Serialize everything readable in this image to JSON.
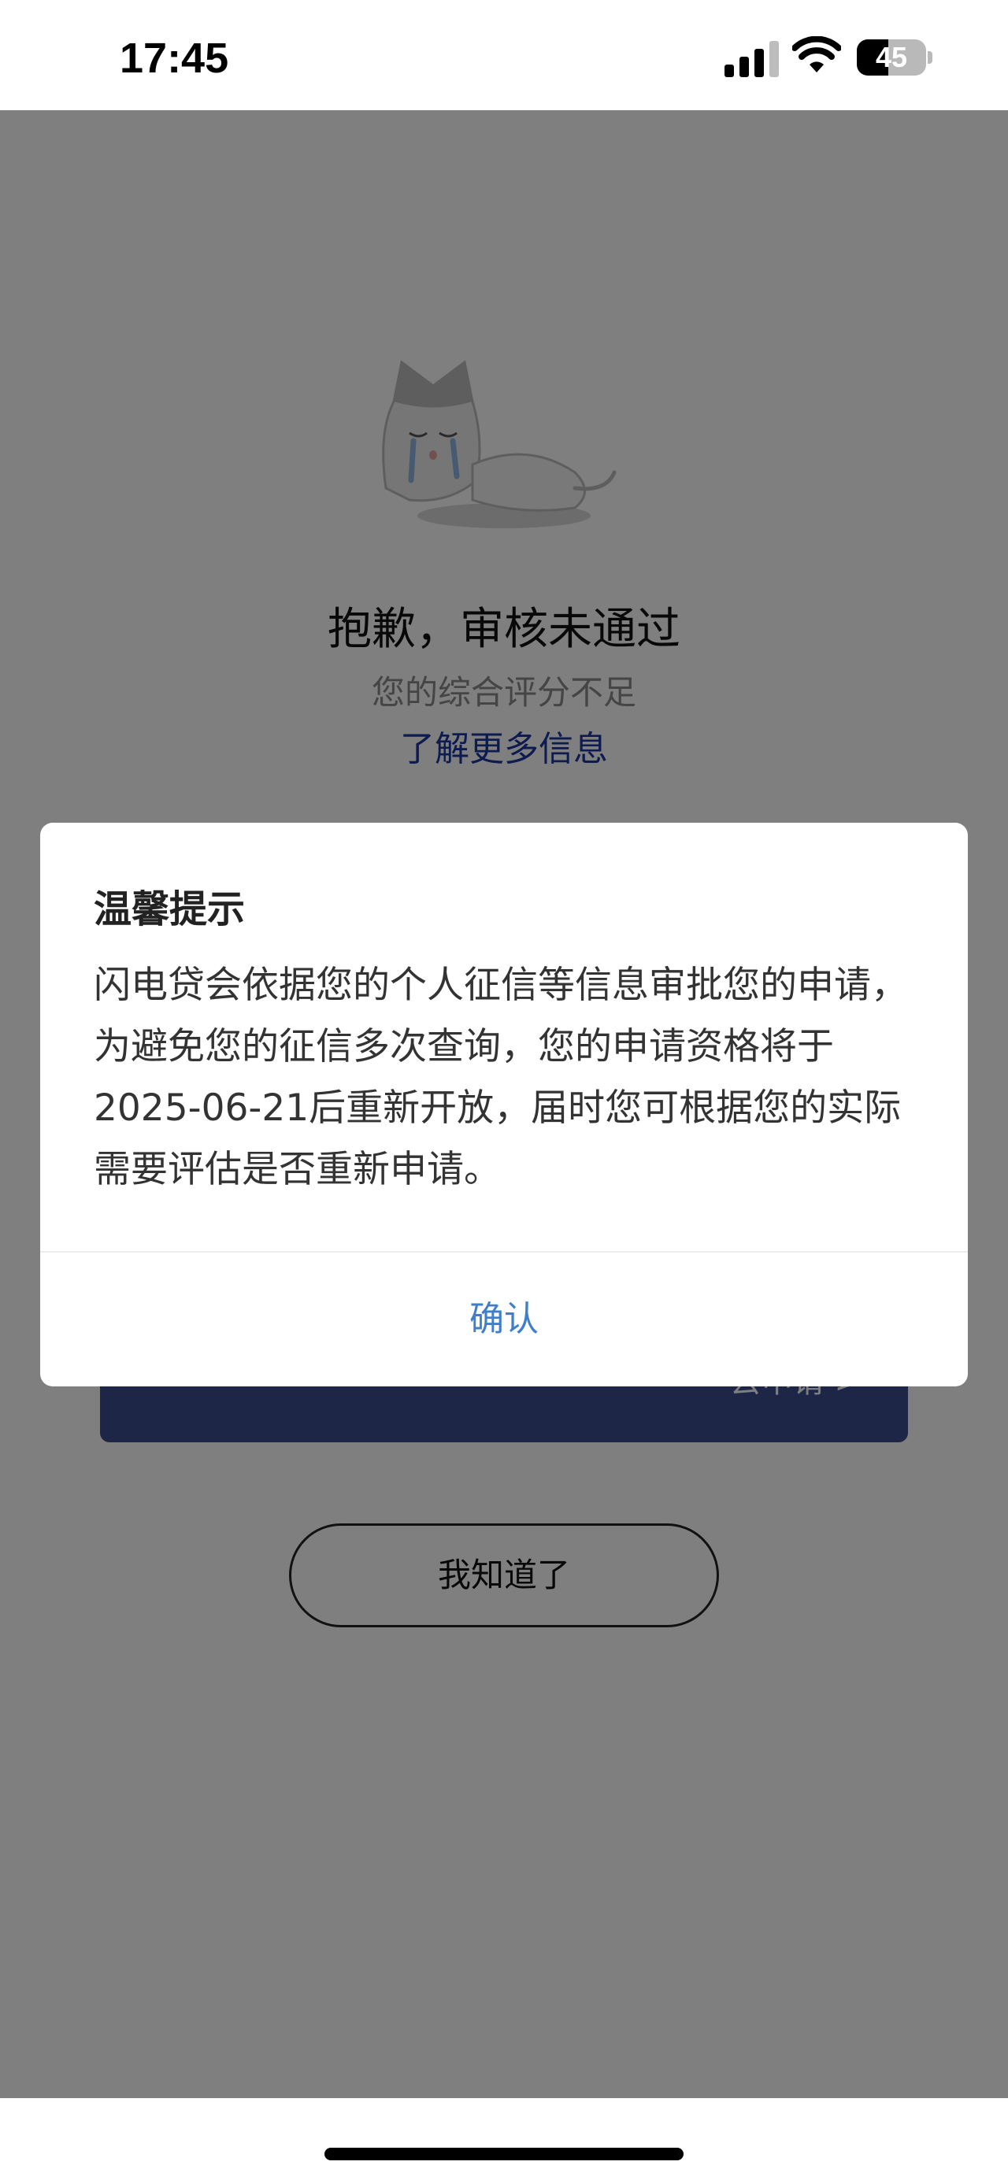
{
  "status_bar": {
    "time": "17:45",
    "battery_level": "45",
    "battery_fraction": 0.45,
    "icons": [
      "signal-icon",
      "wifi-icon",
      "battery-icon"
    ]
  },
  "result": {
    "title": "抱歉，审核未通过",
    "subtitle": "您的综合评分不足",
    "more_info_link": "了解更多信息"
  },
  "apply_banner": {
    "label": "去申请 >"
  },
  "ack_button": {
    "label": "我知道了"
  },
  "dialog": {
    "title": "温馨提示",
    "message": "闪电贷会依据您的个人征信等信息审批您的申请，为避免您的征信多次查询，您的申请资格将于2025-06-21后重新开放，届时您可根据您的实际需要评估是否重新申请。",
    "confirm_label": "确认"
  },
  "colors": {
    "link": "#1a36a0",
    "confirm": "#3f7fc9",
    "banner": "#3a4c8e",
    "overlay": "rgba(0,0,0,0.5)"
  }
}
